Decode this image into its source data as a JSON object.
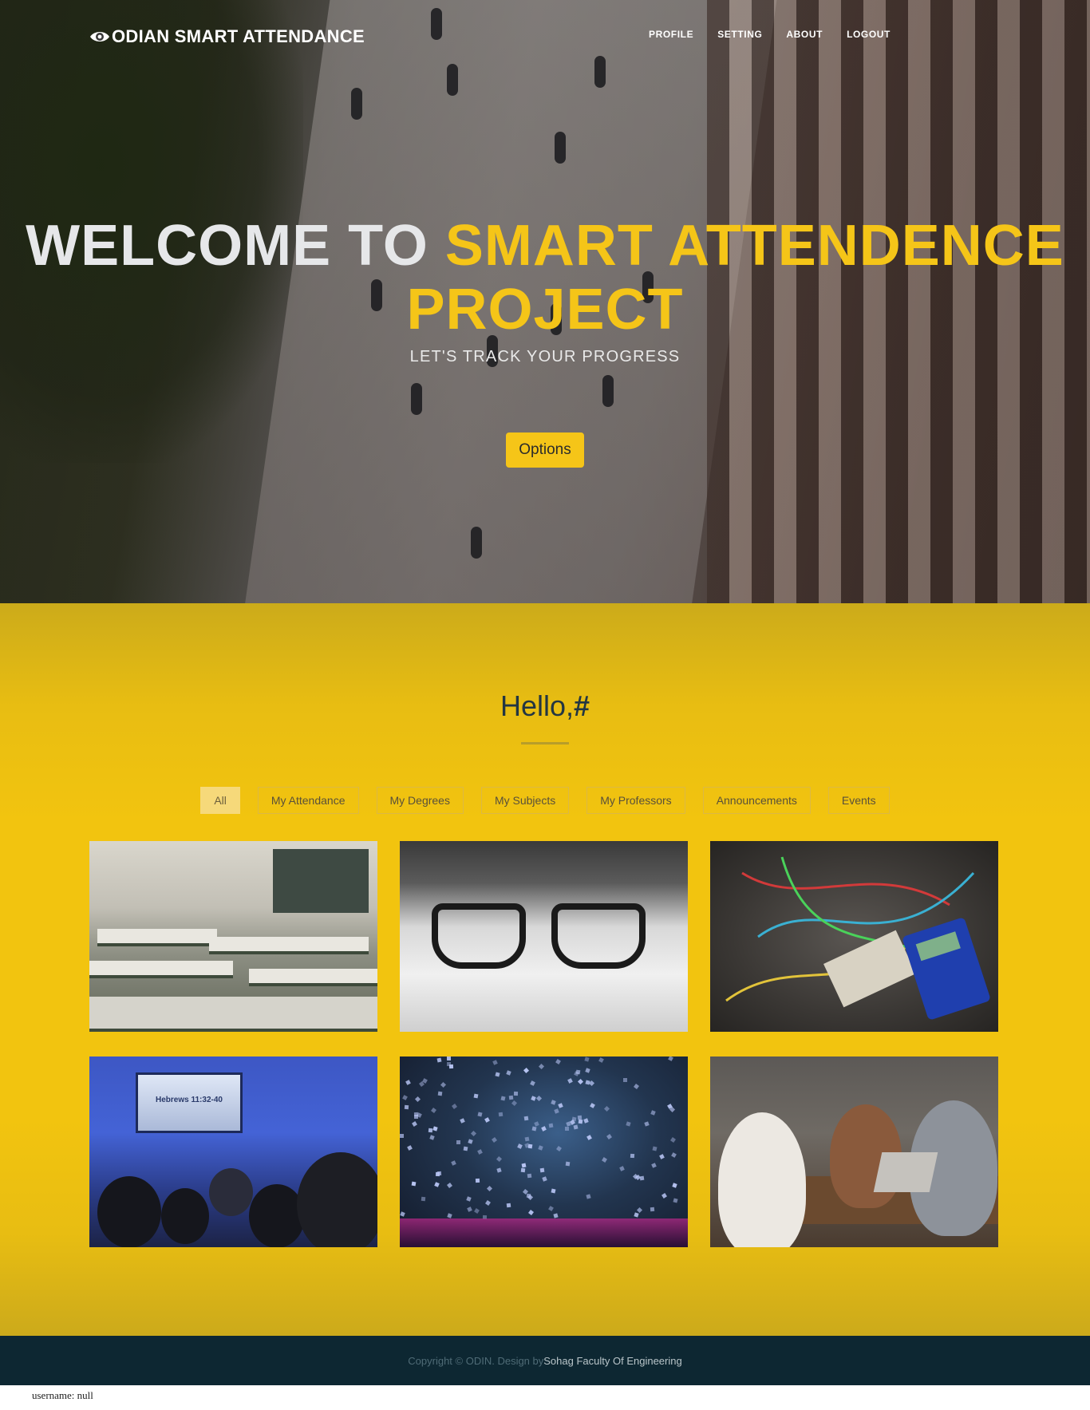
{
  "brand": {
    "name": "ODIAN SMART ATTENDANCE",
    "icon": "eye-icon"
  },
  "nav": {
    "items": [
      "PROFILE",
      "SETTING",
      "ABOUT",
      "LOGOUT"
    ]
  },
  "hero": {
    "title_white": "WELCOME TO ",
    "title_yellow": "SMART ATTENDENCE PROJECT",
    "subtitle": "LET'S TRACK YOUR PROGRESS",
    "options_label": "Options"
  },
  "greeting": {
    "hello": "Hello,",
    "name": "#"
  },
  "filters": [
    "All",
    "My Attendance",
    "My Degrees",
    "My Subjects",
    "My Professors",
    "Announcements",
    "Events"
  ],
  "tiles": [
    {
      "name": "classroom-photo"
    },
    {
      "name": "glasses-photo"
    },
    {
      "name": "electronics-photo"
    },
    {
      "name": "lecture-photo",
      "screen_text": "Hebrews 11:32-40"
    },
    {
      "name": "confetti-event-photo"
    },
    {
      "name": "friends-cafe-photo"
    }
  ],
  "footer": {
    "copyright": "Copyright © ODIN. Design by ",
    "designer": "Sohag Faculty Of Engineering"
  },
  "status": {
    "username": "username: null"
  },
  "colors": {
    "accent": "#f5c518",
    "section": "#f2c40f",
    "footer": "#0d2732",
    "heading": "#233642"
  }
}
